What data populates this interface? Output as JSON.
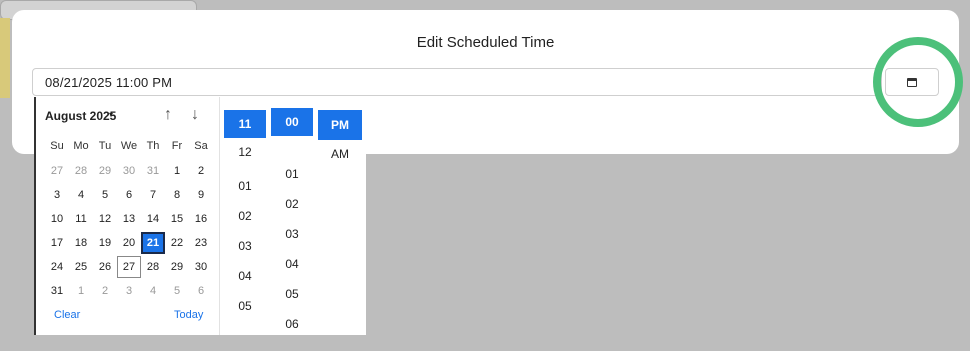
{
  "modal": {
    "title": "Edit Scheduled Time",
    "datetime_value": "08/21/2025 11:00 PM",
    "calendar_button_icon": "calendar-icon"
  },
  "highlight": {
    "color": "#4cc07a"
  },
  "calendar": {
    "month_label": "August 2025",
    "caret": "▾",
    "prev": "↑",
    "next": "↓",
    "weekdays": [
      "Su",
      "Mo",
      "Tu",
      "We",
      "Th",
      "Fr",
      "Sa"
    ],
    "weeks": [
      [
        "27",
        "28",
        "29",
        "30",
        "31",
        "1",
        "2"
      ],
      [
        "3",
        "4",
        "5",
        "6",
        "7",
        "8",
        "9"
      ],
      [
        "10",
        "11",
        "12",
        "13",
        "14",
        "15",
        "16"
      ],
      [
        "17",
        "18",
        "19",
        "20",
        "21",
        "22",
        "23"
      ],
      [
        "24",
        "25",
        "26",
        "27",
        "28",
        "29",
        "30"
      ],
      [
        "31",
        "1",
        "2",
        "3",
        "4",
        "5",
        "6"
      ]
    ],
    "selected_day": "21",
    "today_day": "27",
    "clear_label": "Clear",
    "today_label": "Today"
  },
  "time": {
    "hour_selected": "11",
    "hours": [
      "12",
      "01",
      "02",
      "03",
      "04",
      "05"
    ],
    "minute_selected": "00",
    "minutes": [
      "01",
      "02",
      "03",
      "04",
      "05",
      "06"
    ],
    "ampm_selected": "PM",
    "ampm_other": "AM"
  },
  "colors": {
    "accent": "#1a73e8",
    "backdrop": "#bdbdbd"
  }
}
